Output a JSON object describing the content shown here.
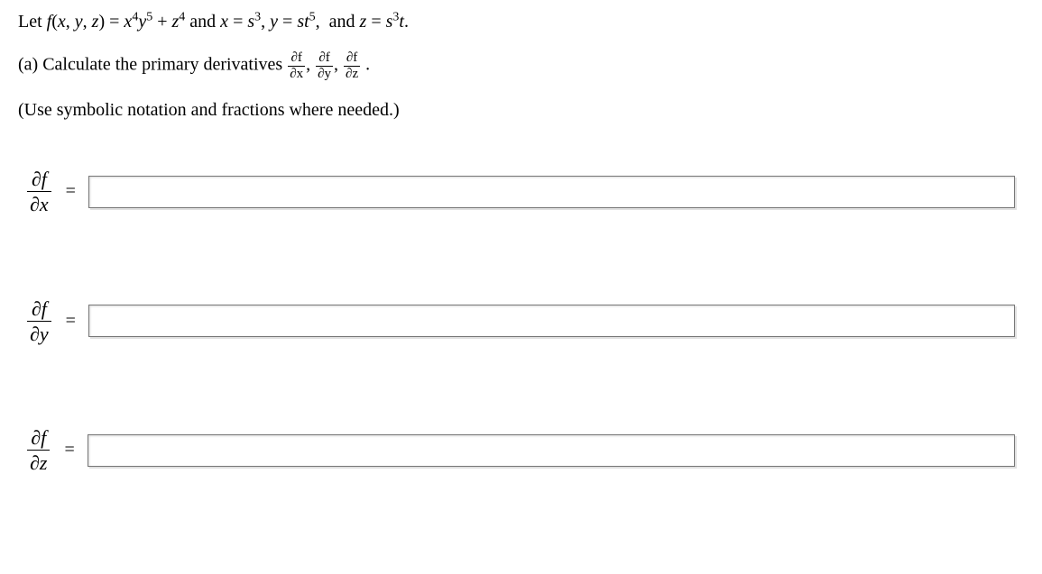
{
  "problem": {
    "intro_html": "Let <span class='ital'>f</span>(<span class='ital'>x</span>, <span class='ital'>y</span>, <span class='ital'>z</span>) = <span class='ital'>x</span><sup>4</sup><span class='ital'>y</span><sup>5</sup> + <span class='ital'>z</span><sup>4</sup> and <span class='ital'>x</span> = <span class='ital'>s</span><sup>3</sup>, <span class='ital'>y</span> = <span class='ital'>st</span><sup>5</sup>,&nbsp; and <span class='ital'>z</span> = <span class='ital'>s</span><sup>3</sup><span class='ital'>t</span>.",
    "part_a_prefix": "(a) Calculate the primary derivatives ",
    "deriv_list": [
      {
        "num": "∂f",
        "den": "∂x"
      },
      {
        "num": "∂f",
        "den": "∂y"
      },
      {
        "num": "∂f",
        "den": "∂z"
      }
    ],
    "note": "(Use symbolic notation and fractions where needed.)"
  },
  "answers": [
    {
      "label_num": "∂f",
      "label_den": "∂x",
      "value": ""
    },
    {
      "label_num": "∂f",
      "label_den": "∂y",
      "value": ""
    },
    {
      "label_num": "∂f",
      "label_den": "∂z",
      "value": ""
    }
  ]
}
